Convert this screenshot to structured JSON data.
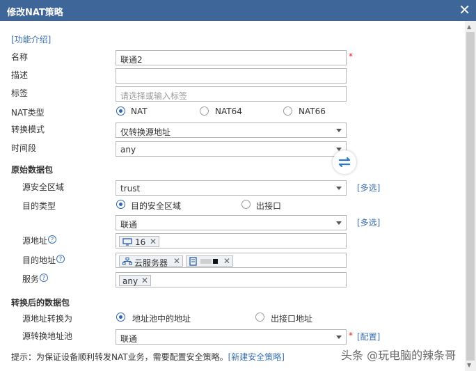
{
  "dialog": {
    "title": "修改NAT策略"
  },
  "intro_link": "[功能介绍]",
  "name": {
    "label": "名称",
    "value": "联通2",
    "required": "*"
  },
  "description": {
    "label": "描述",
    "value": ""
  },
  "tag": {
    "label": "标签",
    "placeholder": "请选择或输入标签"
  },
  "nat_type": {
    "label": "NAT类型",
    "options": [
      "NAT",
      "NAT64",
      "NAT66"
    ],
    "selected": "NAT"
  },
  "convert_mode": {
    "label": "转换模式",
    "value": "仅转换源地址"
  },
  "time_range": {
    "label": "时间段",
    "value": "any"
  },
  "original_packet": {
    "heading": "原始数据包",
    "source_zone": {
      "label": "源安全区域",
      "value": "trust",
      "multi_link": "[多选]"
    },
    "dest_type": {
      "label": "目的类型",
      "options": [
        "目的安全区域",
        "出接口"
      ],
      "selected": "目的安全区域"
    },
    "dest_zone": {
      "value": "联通",
      "multi_link": "[多选]"
    },
    "source_address": {
      "label": "源地址",
      "help": "?",
      "tags": [
        "16"
      ]
    },
    "dest_address": {
      "label": "目的地址",
      "help": "?",
      "tags": [
        "云服务器",
        ""
      ]
    },
    "service": {
      "label": "服务",
      "help": "?",
      "tags": [
        "any"
      ]
    }
  },
  "translated_packet": {
    "heading": "转换后的数据包",
    "source_translate": {
      "label": "源地址转换为",
      "options": [
        "地址池中的地址",
        "出接口地址"
      ],
      "selected": "地址池中的地址"
    },
    "source_pool": {
      "label": "源转换地址池",
      "value": "联通",
      "required": "*",
      "config_link": "[配置]"
    }
  },
  "footer": {
    "note": "提示：为保证设备顺利转发NAT业务，需要配置安全策略。",
    "link": "[新建安全策略]"
  },
  "watermark": "头条 @玩电脑的辣条哥",
  "colors": {
    "titlebar": "#3f6698",
    "link": "#3a6fb0",
    "required": "#e02020",
    "radio_on": "#2d63b6"
  }
}
